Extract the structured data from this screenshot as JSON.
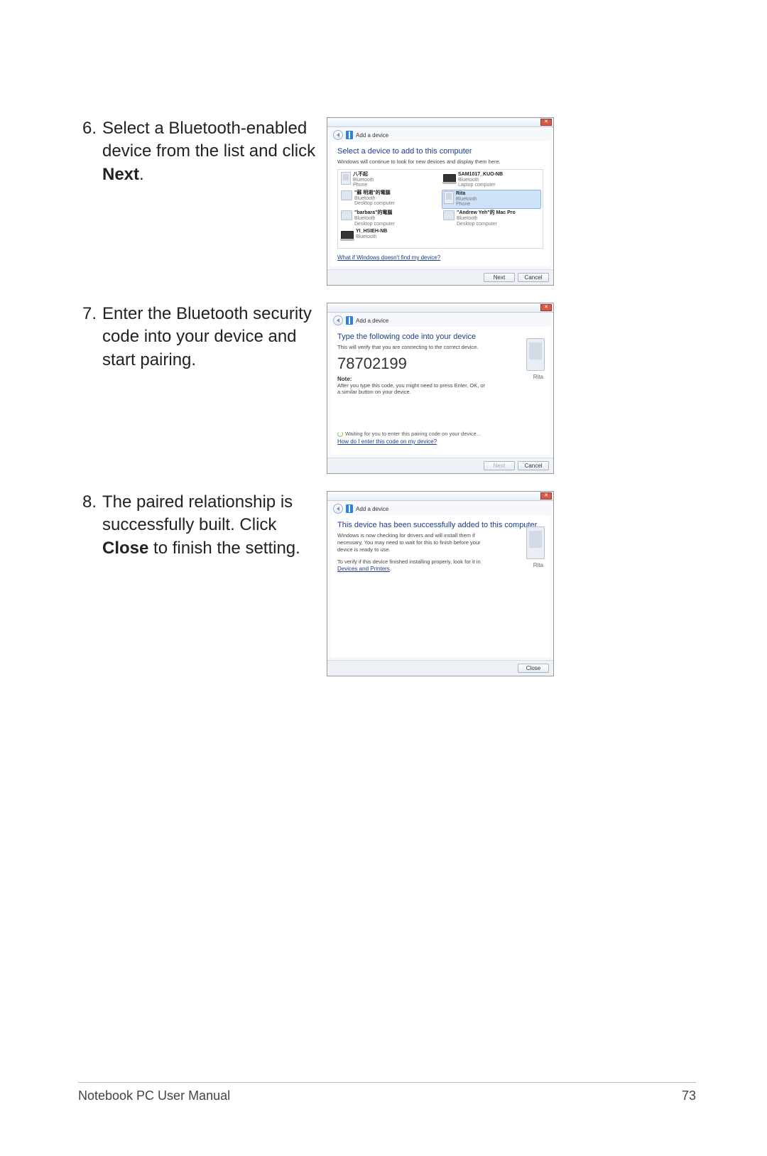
{
  "steps": {
    "s6": {
      "num": "6.",
      "text_a": "Select a Bluetooth-enabled device from the list and click ",
      "bold": "Next",
      "text_b": "."
    },
    "s7": {
      "num": "7.",
      "text": "Enter the Bluetooth security code into your device and start pairing."
    },
    "s8": {
      "num": "8.",
      "text_a": "The paired relationship is successfully built. Click ",
      "bold": "Close",
      "text_b": " to finish the setting."
    }
  },
  "dialog1": {
    "crumb": "Add a device",
    "title": "Select a device to add to this computer",
    "hint": "Windows will continue to look for new devices and display them here.",
    "devices": [
      {
        "name": "八不起",
        "type1": "Bluetooth",
        "type2": "Phone",
        "ico": "phone",
        "sel": false
      },
      {
        "name": "SAM1017_KUO-NB",
        "type1": "Bluetooth",
        "type2": "Laptop computer",
        "ico": "laptop",
        "sel": false
      },
      {
        "name": "\"蘇 明湘\"的電腦",
        "type1": "Bluetooth",
        "type2": "Desktop computer",
        "ico": "desk",
        "sel": false
      },
      {
        "name": "Rita",
        "type1": "Bluetooth",
        "type2": "Phone",
        "ico": "phone",
        "sel": true
      },
      {
        "name": "\"barbara\"的電腦",
        "type1": "Bluetooth",
        "type2": "Desktop computer",
        "ico": "desk",
        "sel": false
      },
      {
        "name": "\"Andrew Yeh\"的 Mac Pro",
        "type1": "Bluetooth",
        "type2": "Desktop computer",
        "ico": "desk",
        "sel": false
      },
      {
        "name": "YI_HSIEH-NB",
        "type1": "Bluetooth",
        "type2": "",
        "ico": "laptop",
        "sel": false
      }
    ],
    "help_link": "What if Windows doesn't find my device?",
    "next": "Next",
    "cancel": "Cancel"
  },
  "dialog2": {
    "crumb": "Add a device",
    "title": "Type the following code into your device",
    "hint": "This will verify that you are connecting to the correct device.",
    "code": "78702199",
    "note_label": "Note:",
    "note_text": "After you type this code, you might need to press Enter, OK, or a similar button on your device.",
    "phone_label": "Rita",
    "waiting": "Waiting for you to enter this pairing code on your device...",
    "help_link": "How do I enter this code on my device?",
    "next": "Next",
    "cancel": "Cancel"
  },
  "dialog3": {
    "crumb": "Add a device",
    "title": "This device has been successfully added to this computer",
    "text1": "Windows is now checking for drivers and will install them if necessary. You may need to wait for this to finish before your device is ready to use.",
    "text2": "To verify if this device finished installing properly, look for it in ",
    "link": "Devices and Printers",
    "phone_label": "Rita",
    "close": "Close"
  },
  "footer": {
    "left": "Notebook PC User Manual",
    "right": "73"
  }
}
